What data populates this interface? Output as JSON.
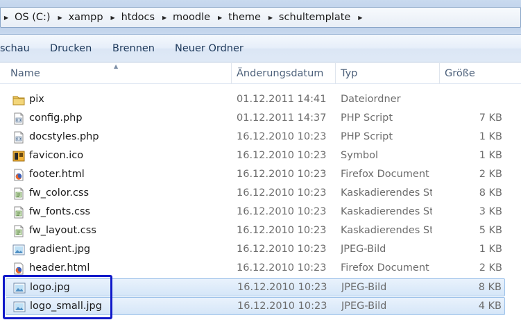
{
  "breadcrumb": {
    "items": [
      {
        "label": "OS (C:)"
      },
      {
        "label": "xampp"
      },
      {
        "label": "htdocs"
      },
      {
        "label": "moodle"
      },
      {
        "label": "theme"
      },
      {
        "label": "schultemplate"
      }
    ]
  },
  "toolbar": {
    "preview_label": "schau",
    "print_label": "Drucken",
    "burn_label": "Brennen",
    "new_folder_label": "Neuer Ordner"
  },
  "columns": {
    "name": "Name",
    "date": "Änderungsdatum",
    "type": "Typ",
    "size": "Größe"
  },
  "files": [
    {
      "name": "pix",
      "date": "01.12.2011 14:41",
      "type": "Dateiordner",
      "size": "",
      "icon": "folder-icon",
      "selected": false
    },
    {
      "name": "config.php",
      "date": "01.12.2011 14:37",
      "type": "PHP Script",
      "size": "7 KB",
      "icon": "script-file-icon",
      "selected": false
    },
    {
      "name": "docstyles.php",
      "date": "16.12.2010 10:23",
      "type": "PHP Script",
      "size": "1 KB",
      "icon": "script-file-icon",
      "selected": false
    },
    {
      "name": "favicon.ico",
      "date": "16.12.2010 10:23",
      "type": "Symbol",
      "size": "1 KB",
      "icon": "favicon-file-icon",
      "selected": false
    },
    {
      "name": "footer.html",
      "date": "16.12.2010 10:23",
      "type": "Firefox Document",
      "size": "2 KB",
      "icon": "firefox-document-icon",
      "selected": false
    },
    {
      "name": "fw_color.css",
      "date": "16.12.2010 10:23",
      "type": "Kaskadierendes St...",
      "size": "8 KB",
      "icon": "css-file-icon",
      "selected": false
    },
    {
      "name": "fw_fonts.css",
      "date": "16.12.2010 10:23",
      "type": "Kaskadierendes St...",
      "size": "3 KB",
      "icon": "css-file-icon",
      "selected": false
    },
    {
      "name": "fw_layout.css",
      "date": "16.12.2010 10:23",
      "type": "Kaskadierendes St...",
      "size": "5 KB",
      "icon": "css-file-icon",
      "selected": false
    },
    {
      "name": "gradient.jpg",
      "date": "16.12.2010 10:23",
      "type": "JPEG-Bild",
      "size": "1 KB",
      "icon": "image-file-icon",
      "selected": false
    },
    {
      "name": "header.html",
      "date": "16.12.2010 10:23",
      "type": "Firefox Document",
      "size": "2 KB",
      "icon": "firefox-document-icon",
      "selected": false
    },
    {
      "name": "logo.jpg",
      "date": "16.12.2010 10:23",
      "type": "JPEG-Bild",
      "size": "8 KB",
      "icon": "image-file-icon",
      "selected": true
    },
    {
      "name": "logo_small.jpg",
      "date": "16.12.2010 10:23",
      "type": "JPEG-Bild",
      "size": "4 KB",
      "icon": "image-file-icon",
      "selected": true
    }
  ],
  "colors": {
    "selection_border": "#9fc3ea",
    "highlight_box": "#1019c9",
    "toolbar_text": "#1e395b"
  }
}
